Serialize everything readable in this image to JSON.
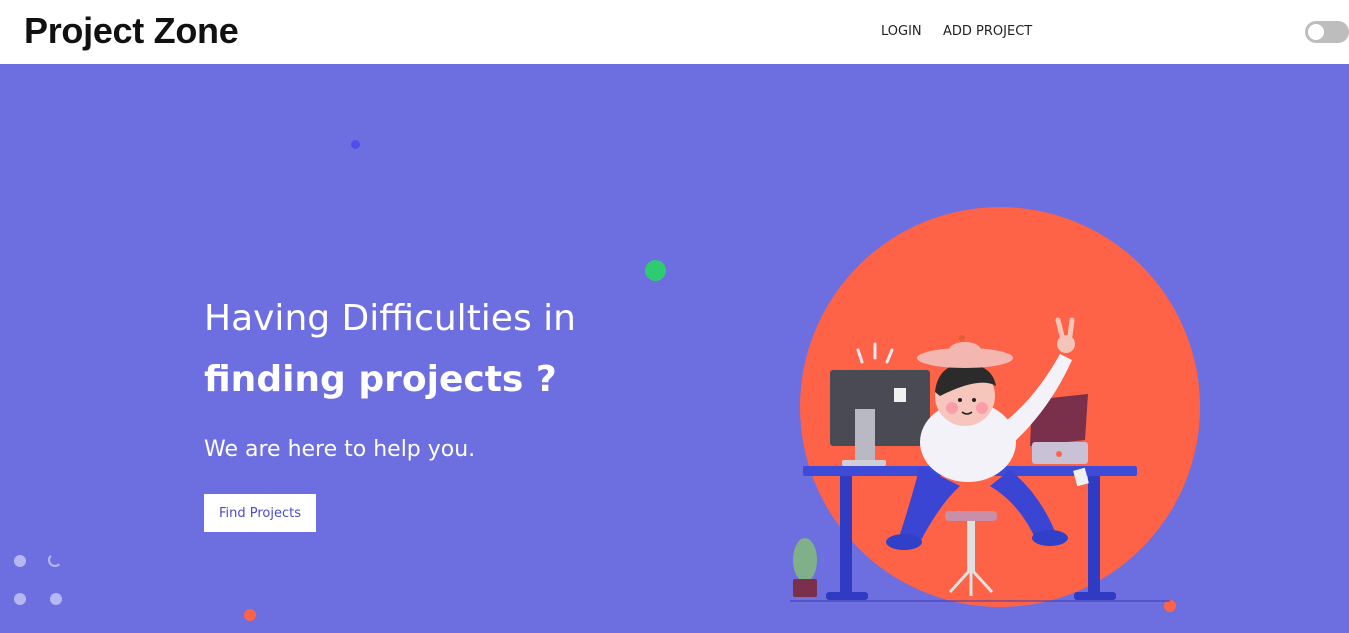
{
  "navbar": {
    "brand": "Project Zone",
    "links": [
      "LOGIN",
      "ADD PROJECT"
    ],
    "theme_toggle": {
      "state": "off",
      "icon": "toggle-switch"
    }
  },
  "hero": {
    "headline_line1": "Having Difficulties in",
    "headline_line2": "finding projects ?",
    "subtitle": "We are here to help you.",
    "cta_label": "Find Projects",
    "illustration": "person-at-desk-illustration"
  },
  "colors": {
    "background": "#6d6ee0",
    "circle": "#ff6347",
    "accent_green": "#2ecc71",
    "button_text": "#4b4bc8"
  }
}
